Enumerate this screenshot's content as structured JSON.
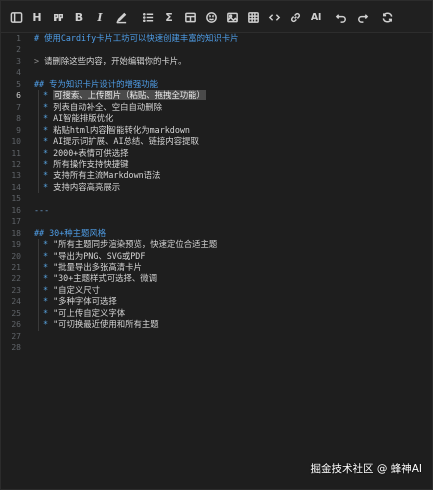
{
  "toolbar": {
    "buttons": [
      {
        "name": "sidebar-toggle",
        "icon": "sidebar-icon"
      },
      {
        "name": "heading",
        "icon": "heading-icon",
        "label": "H"
      },
      {
        "name": "quote",
        "icon": "quote-icon",
        "label": "99"
      },
      {
        "name": "bold",
        "icon": "bold-icon",
        "label": "B"
      },
      {
        "name": "italic",
        "icon": "italic-icon",
        "label": "I"
      },
      {
        "name": "highlight",
        "icon": "highlighter-icon"
      },
      {
        "name": "list",
        "icon": "list-icon"
      },
      {
        "name": "formula",
        "icon": "sigma-icon",
        "label": "Σ"
      },
      {
        "name": "table-insert",
        "icon": "table-icon"
      },
      {
        "name": "emoji",
        "icon": "smiley-icon"
      },
      {
        "name": "image",
        "icon": "image-icon"
      },
      {
        "name": "grid",
        "icon": "grid-icon"
      },
      {
        "name": "code",
        "icon": "code-icon"
      },
      {
        "name": "link",
        "icon": "link-icon"
      },
      {
        "name": "ai",
        "icon": "ai-icon",
        "label": "AI"
      },
      {
        "name": "undo",
        "icon": "undo-icon"
      },
      {
        "name": "redo",
        "icon": "redo-icon"
      },
      {
        "name": "refresh",
        "icon": "refresh-icon"
      }
    ],
    "heading_label": "H",
    "quote_label": "99",
    "bold_label": "B",
    "italic_label": "I",
    "formula_label": "Σ",
    "ai_label": "AI"
  },
  "editor": {
    "current_line": 6,
    "lines": [
      {
        "n": "1",
        "parts": [
          {
            "t": "# 使用Cardify卡片工坊可以快速创建丰富的知识卡片",
            "c": "heading"
          }
        ]
      },
      {
        "n": "2",
        "parts": []
      },
      {
        "n": "3",
        "parts": [
          {
            "t": "> ",
            "c": "quote-mark"
          },
          {
            "t": "请删除这些内容，开始编辑你的卡片。",
            "c": ""
          }
        ]
      },
      {
        "n": "4",
        "parts": []
      },
      {
        "n": "5",
        "parts": [
          {
            "t": "## 专为知识卡片设计的增强功能",
            "c": "heading"
          }
        ]
      },
      {
        "n": "6",
        "indent": true,
        "parts": [
          {
            "t": "* ",
            "c": "bullet-star"
          },
          {
            "t": "可搜索、上传图片（粘贴、拖拽全功能）",
            "c": "hl"
          }
        ]
      },
      {
        "n": "7",
        "indent": true,
        "parts": [
          {
            "t": "* ",
            "c": "bullet-star"
          },
          {
            "t": "列表自动补全、空白自动删除",
            "c": ""
          }
        ]
      },
      {
        "n": "8",
        "indent": true,
        "parts": [
          {
            "t": "* ",
            "c": "bullet-star"
          },
          {
            "t": "AI智能排版优化",
            "c": ""
          }
        ]
      },
      {
        "n": "9",
        "indent": true,
        "parts": [
          {
            "t": "* ",
            "c": "bullet-star"
          },
          {
            "t": "粘贴html内容",
            "c": ""
          },
          {
            "t": "CARET",
            "c": "caret"
          },
          {
            "t": "智能转化为markdown",
            "c": ""
          }
        ]
      },
      {
        "n": "10",
        "indent": true,
        "parts": [
          {
            "t": "* ",
            "c": "bullet-star"
          },
          {
            "t": "AI提示词扩展、AI总结、链接内容提取",
            "c": ""
          }
        ]
      },
      {
        "n": "11",
        "indent": true,
        "parts": [
          {
            "t": "* ",
            "c": "bullet-star"
          },
          {
            "t": "2000+表情可供选择",
            "c": ""
          }
        ]
      },
      {
        "n": "12",
        "indent": true,
        "parts": [
          {
            "t": "* ",
            "c": "bullet-star"
          },
          {
            "t": "所有操作支持快捷键",
            "c": ""
          }
        ]
      },
      {
        "n": "13",
        "indent": true,
        "parts": [
          {
            "t": "* ",
            "c": "bullet-star"
          },
          {
            "t": "支持所有主流Markdown语法",
            "c": ""
          }
        ]
      },
      {
        "n": "14",
        "indent": true,
        "parts": [
          {
            "t": "* ",
            "c": "bullet-star"
          },
          {
            "t": "支持内容高亮展示",
            "c": ""
          }
        ]
      },
      {
        "n": "15",
        "parts": []
      },
      {
        "n": "16",
        "parts": [
          {
            "t": "---",
            "c": "hr"
          }
        ]
      },
      {
        "n": "17",
        "parts": []
      },
      {
        "n": "18",
        "parts": [
          {
            "t": "## 30+种主题风格",
            "c": "heading"
          }
        ]
      },
      {
        "n": "19",
        "indent": true,
        "parts": [
          {
            "t": "* ",
            "c": "bullet-star"
          },
          {
            "t": "\"所有主题同步渲染预览，快速定位合适主题",
            "c": ""
          }
        ]
      },
      {
        "n": "20",
        "indent": true,
        "parts": [
          {
            "t": "* ",
            "c": "bullet-star"
          },
          {
            "t": "\"导出为PNG、SVG或PDF",
            "c": ""
          }
        ]
      },
      {
        "n": "21",
        "indent": true,
        "parts": [
          {
            "t": "* ",
            "c": "bullet-star"
          },
          {
            "t": "\"批量导出多张高清卡片",
            "c": ""
          }
        ]
      },
      {
        "n": "22",
        "indent": true,
        "parts": [
          {
            "t": "* ",
            "c": "bullet-star"
          },
          {
            "t": "\"30+主题样式可选择、微调",
            "c": ""
          }
        ]
      },
      {
        "n": "23",
        "indent": true,
        "parts": [
          {
            "t": "* ",
            "c": "bullet-star"
          },
          {
            "t": "\"自定义尺寸",
            "c": ""
          }
        ]
      },
      {
        "n": "24",
        "indent": true,
        "parts": [
          {
            "t": "* ",
            "c": "bullet-star"
          },
          {
            "t": "\"多种字体可选择",
            "c": ""
          }
        ]
      },
      {
        "n": "25",
        "indent": true,
        "parts": [
          {
            "t": "* ",
            "c": "bullet-star"
          },
          {
            "t": "\"可上传自定义字体",
            "c": ""
          }
        ]
      },
      {
        "n": "26",
        "indent": true,
        "parts": [
          {
            "t": "* ",
            "c": "bullet-star"
          },
          {
            "t": "\"可切换最近使用和所有主题",
            "c": ""
          }
        ]
      },
      {
        "n": "27",
        "parts": []
      },
      {
        "n": "28",
        "parts": []
      }
    ]
  },
  "watermark": "掘金技术社区 @ 蜂神AI",
  "colors": {
    "background": "#1e1e1e",
    "heading": "#4f9ee8",
    "line_number": "#5f6368",
    "highlight": "#4a4a4a"
  }
}
